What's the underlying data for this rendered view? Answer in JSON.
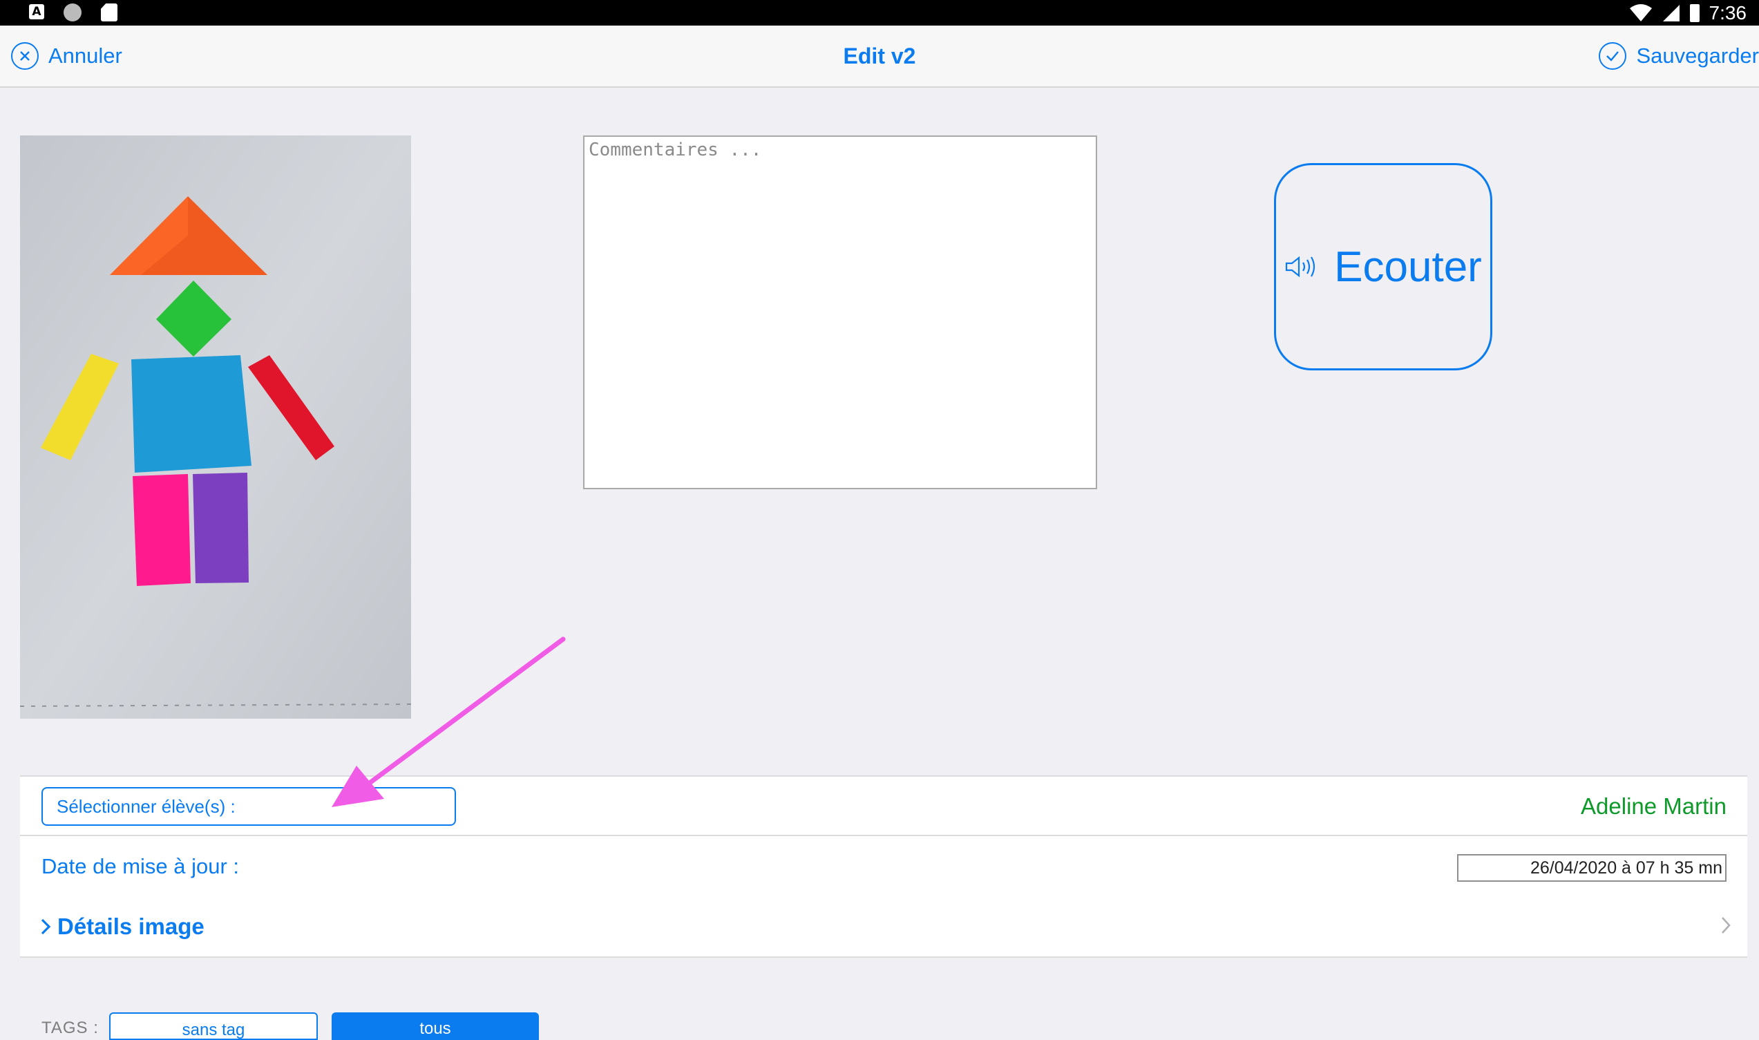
{
  "status_bar": {
    "time": "7:36",
    "left_icons": [
      "a-icon",
      "circle-icon",
      "sd-card-icon"
    ],
    "right_icons": [
      "wifi-icon",
      "signal-icon",
      "battery-icon"
    ]
  },
  "nav": {
    "cancel_label": "Annuler",
    "title": "Edit v2",
    "save_label": "Sauvegarder"
  },
  "comment": {
    "placeholder": "Commentaires ...",
    "value": ""
  },
  "listen": {
    "label": "Ecouter",
    "icon": "speaker-icon"
  },
  "students": {
    "select_label": "Sélectionner élève(s) :",
    "selected": "Adeline Martin"
  },
  "update": {
    "label": "Date de mise à jour :",
    "value": "26/04/2020 à 07 h 35 mn"
  },
  "details": {
    "label": "Détails image"
  },
  "tags": {
    "label": "TAGS :",
    "items": [
      "sans tag",
      "tous"
    ],
    "active": "tous"
  },
  "colors": {
    "accent": "#0a7cf0",
    "student": "#0e9a2a",
    "annotation_arrow": "#f15ce6",
    "background": "#efeff4"
  }
}
